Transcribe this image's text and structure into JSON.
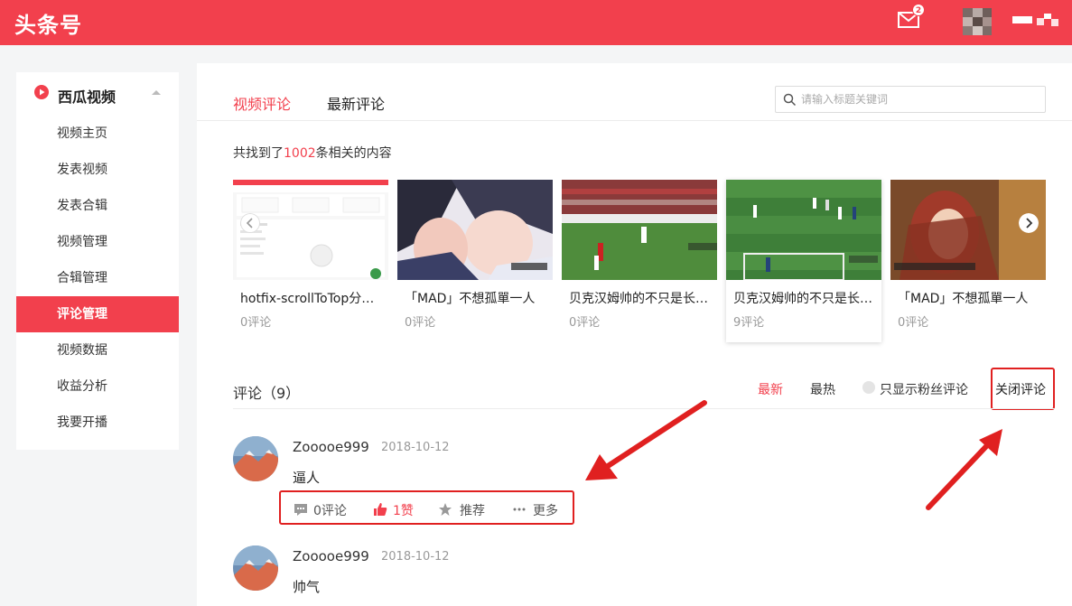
{
  "header": {
    "logo": "头条号",
    "mail_badge": "2"
  },
  "sidebar": {
    "section_title": "西瓜视频",
    "items": [
      {
        "label": "视频主页"
      },
      {
        "label": "发表视频"
      },
      {
        "label": "发表合辑"
      },
      {
        "label": "视频管理"
      },
      {
        "label": "合辑管理"
      },
      {
        "label": "评论管理",
        "active": true
      },
      {
        "label": "视频数据"
      },
      {
        "label": "收益分析"
      },
      {
        "label": "我要开播"
      }
    ]
  },
  "main": {
    "tabs": [
      {
        "label": "视频评论",
        "active": true
      },
      {
        "label": "最新评论"
      }
    ],
    "search": {
      "placeholder": "请输入标题关键词"
    },
    "found": {
      "prefix": "共找到了",
      "count": "1002",
      "suffix": "条相关的内容"
    },
    "videos": [
      {
        "title": "hotfix-scrollToTop分支预览",
        "comments": "0评论"
      },
      {
        "title": "「MAD」不想孤單一人",
        "comments": "0评论"
      },
      {
        "title": "贝克汉姆帅的不只是长相，还有他的任意球",
        "comments": "0评论"
      },
      {
        "title": "贝克汉姆帅的不只是长相，还有他的任意球",
        "comments": "9评论",
        "selected": true
      },
      {
        "title": "「MAD」不想孤單一人",
        "comments": "0评论"
      }
    ],
    "comments_section": {
      "title": "评论（9）",
      "sort_new": "最新",
      "sort_hot": "最热",
      "fans_only": "只显示粉丝评论",
      "close_comments": "关闭评论"
    },
    "comments": [
      {
        "user": "Zooooe999",
        "date": "2018-10-12",
        "text": "逼人",
        "actions": {
          "reply": "0评论",
          "like": "1赞",
          "recommend": "推荐",
          "more": "更多"
        }
      },
      {
        "user": "Zooooe999",
        "date": "2018-10-12",
        "text": "帅气"
      }
    ]
  },
  "colors": {
    "brand": "#f2404d",
    "annotation": "#e02020"
  }
}
